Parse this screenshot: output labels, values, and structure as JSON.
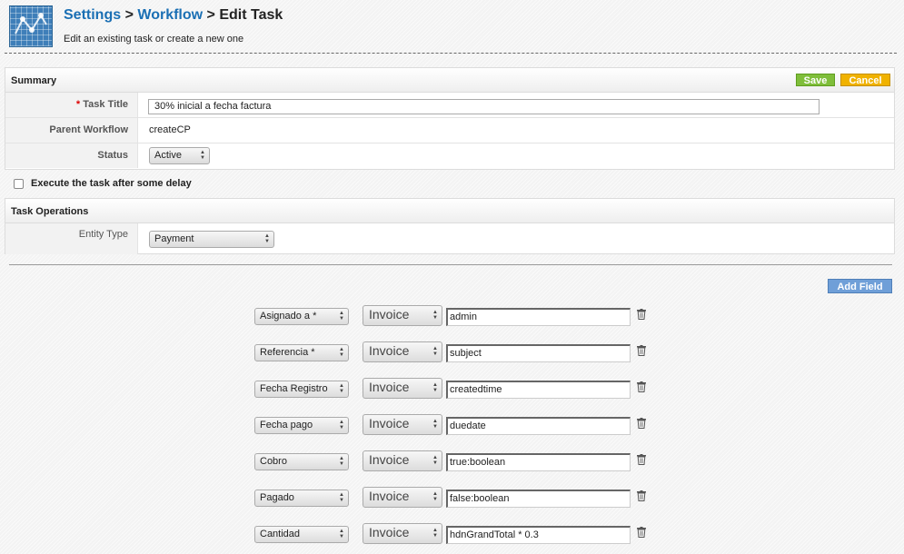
{
  "breadcrumb": {
    "settings": "Settings",
    "sep1": ">",
    "workflow": "Workflow",
    "sep2": ">",
    "current": "Edit Task"
  },
  "subtitle": "Edit an existing task or create a new one",
  "summary": {
    "title": "Summary",
    "save_label": "Save",
    "cancel_label": "Cancel",
    "task_title_required": "*",
    "task_title_label": "Task Title",
    "task_title_value": "30% inicial a fecha factura",
    "parent_workflow_label": "Parent Workflow",
    "parent_workflow_value": "createCP",
    "status_label": "Status",
    "status_value": "Active"
  },
  "delay": {
    "label": "Execute the task after some delay",
    "checked": false
  },
  "task_operations": {
    "title": "Task Operations",
    "entity_type_label": "Entity Type",
    "entity_type_value": "Payment"
  },
  "add_field_label": "Add Field",
  "field_mappings": [
    {
      "field": "Asignado a *",
      "source": "Invoice",
      "value": "admin"
    },
    {
      "field": "Referencia *",
      "source": "Invoice",
      "value": "subject"
    },
    {
      "field": "Fecha Registro",
      "source": "Invoice",
      "value": "createdtime"
    },
    {
      "field": "Fecha pago",
      "source": "Invoice",
      "value": "duedate"
    },
    {
      "field": "Cobro",
      "source": "Invoice",
      "value": "true:boolean"
    },
    {
      "field": "Pagado",
      "source": "Invoice",
      "value": "false:boolean"
    },
    {
      "field": "Cantidad",
      "source": "Invoice",
      "value": "hdnGrandTotal * 0.3"
    }
  ],
  "colors": {
    "link": "#1a6fb4",
    "save": "#7fbe3a",
    "cancel": "#f0b200",
    "add_field": "#6f9fd8"
  },
  "icons": {
    "logo": "workflow-logo-icon",
    "delete": "trash-icon",
    "select_arrows": "updown-arrows-icon"
  }
}
